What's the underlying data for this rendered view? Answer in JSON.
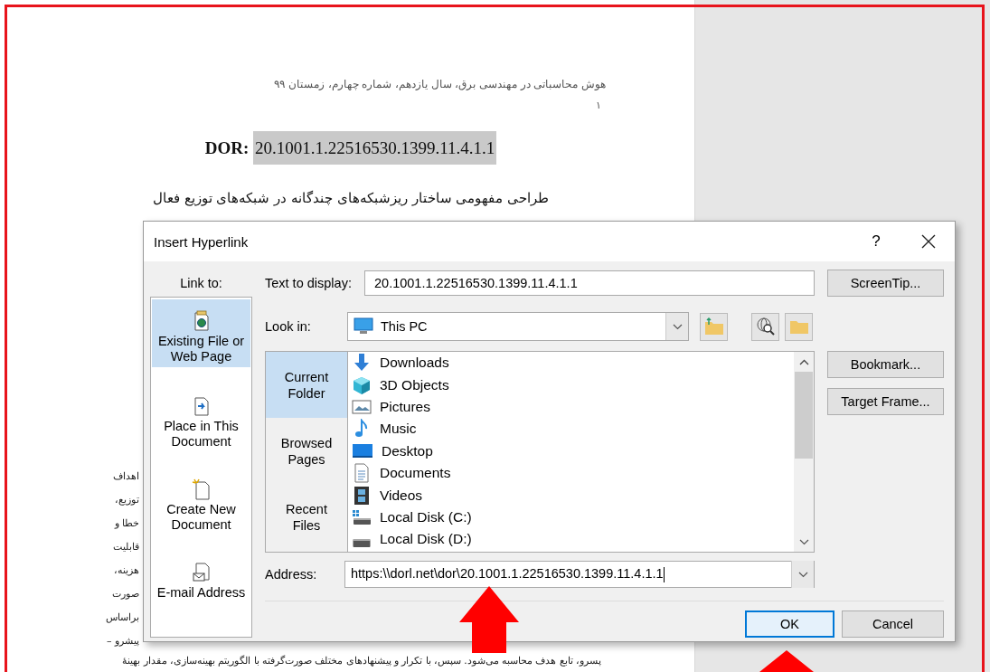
{
  "document": {
    "header": "هوش محاسباتی در مهندسی برق، سال یازدهم، شماره چهارم، زمستان ۹۹",
    "page_number": "۱",
    "dor_label": "DOR:",
    "dor_value": "20.1001.1.22516530.1399.11.4.1.1",
    "title": "طراحی مفهومی ساختار ریزشبکه‌های چندگانه در شبکه‌های توزیع فعال",
    "side_lines": [
      "اهداف",
      "توزیع،",
      "خطا و",
      "قابلیت",
      "هزینه،",
      "صورت",
      "براساس",
      "پیشرو –"
    ],
    "bottom_line": "پسرو، تابع هدف محاسبه می‌شود. سپس، با تکرار و پیشنهادهای مختلف صورت‌گرفته با الگوریتم بهینه‌سازی، مقدار بهینهٔ"
  },
  "dialog": {
    "title": "Insert Hyperlink",
    "help": "?",
    "link_to_label": "Link to:",
    "link_to": [
      {
        "label": "Existing File or Web Page",
        "kind": "file",
        "selected": true
      },
      {
        "label": "Place in This Document",
        "kind": "place",
        "selected": false
      },
      {
        "label": "Create New Document",
        "kind": "new",
        "selected": false
      },
      {
        "label": "E-mail Address",
        "kind": "email",
        "selected": false
      }
    ],
    "text_to_display": {
      "label": "Text to display:",
      "value": "20.1001.1.22516530.1399.11.4.1.1"
    },
    "screentip_button": "ScreenTip...",
    "look_in": {
      "label": "Look in:",
      "value": "This PC"
    },
    "browse": [
      {
        "label": "Current Folder",
        "selected": true
      },
      {
        "label": "Browsed Pages",
        "selected": false
      },
      {
        "label": "Recent Files",
        "selected": false
      }
    ],
    "files": [
      {
        "name": "Downloads",
        "kind": "downloads"
      },
      {
        "name": "3D Objects",
        "kind": "objects"
      },
      {
        "name": "Pictures",
        "kind": "pictures"
      },
      {
        "name": "Music",
        "kind": "music"
      },
      {
        "name": "Desktop",
        "kind": "desktop"
      },
      {
        "name": "Documents",
        "kind": "documents"
      },
      {
        "name": "Videos",
        "kind": "videos"
      },
      {
        "name": "Local Disk (C:)",
        "kind": "system_disk"
      },
      {
        "name": "Local Disk (D:)",
        "kind": "disk"
      }
    ],
    "bookmark_button": "Bookmark...",
    "target_frame_button": "Target Frame...",
    "address": {
      "label": "Address:",
      "value": "https:\\\\dorl.net\\dor\\20.1001.1.22516530.1399.11.4.1.1"
    },
    "buttons": [
      {
        "label": "OK",
        "default": true
      },
      {
        "label": "Cancel",
        "default": false
      }
    ]
  }
}
